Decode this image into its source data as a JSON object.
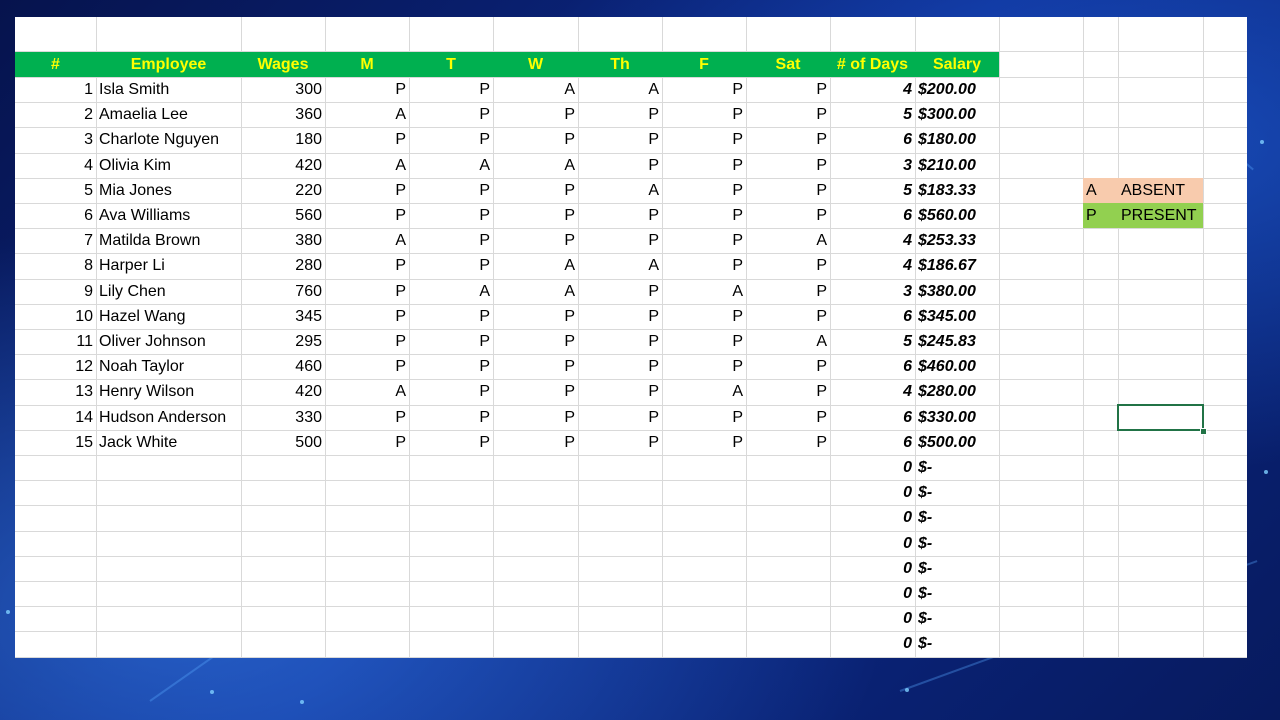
{
  "colors": {
    "header_bg": "#00b050",
    "header_text": "#ffff00",
    "absent_bg": "#f8cbad",
    "present_bg": "#92d050",
    "selection": "#217346"
  },
  "headers": [
    "#",
    "Employee",
    "Wages",
    "M",
    "T",
    "W",
    "Th",
    "F",
    "Sat",
    "# of Days",
    "Salary"
  ],
  "rows": [
    {
      "n": "1",
      "name": "Isla Smith",
      "wages": "300",
      "att": [
        "P",
        "P",
        "A",
        "A",
        "P",
        "P"
      ],
      "days": "4",
      "salary": "$200.00"
    },
    {
      "n": "2",
      "name": "Amaelia Lee",
      "wages": "360",
      "att": [
        "A",
        "P",
        "P",
        "P",
        "P",
        "P"
      ],
      "days": "5",
      "salary": "$300.00"
    },
    {
      "n": "3",
      "name": "Charlote Nguyen",
      "wages": "180",
      "att": [
        "P",
        "P",
        "P",
        "P",
        "P",
        "P"
      ],
      "days": "6",
      "salary": "$180.00"
    },
    {
      "n": "4",
      "name": "Olivia Kim",
      "wages": "420",
      "att": [
        "A",
        "A",
        "A",
        "P",
        "P",
        "P"
      ],
      "days": "3",
      "salary": "$210.00"
    },
    {
      "n": "5",
      "name": "Mia Jones",
      "wages": "220",
      "att": [
        "P",
        "P",
        "P",
        "A",
        "P",
        "P"
      ],
      "days": "5",
      "salary": "$183.33"
    },
    {
      "n": "6",
      "name": "Ava Williams",
      "wages": "560",
      "att": [
        "P",
        "P",
        "P",
        "P",
        "P",
        "P"
      ],
      "days": "6",
      "salary": "$560.00"
    },
    {
      "n": "7",
      "name": "Matilda Brown",
      "wages": "380",
      "att": [
        "A",
        "P",
        "P",
        "P",
        "P",
        "A"
      ],
      "days": "4",
      "salary": "$253.33"
    },
    {
      "n": "8",
      "name": "Harper Li",
      "wages": "280",
      "att": [
        "P",
        "P",
        "A",
        "A",
        "P",
        "P"
      ],
      "days": "4",
      "salary": "$186.67"
    },
    {
      "n": "9",
      "name": "Lily Chen",
      "wages": "760",
      "att": [
        "P",
        "A",
        "A",
        "P",
        "A",
        "P"
      ],
      "days": "3",
      "salary": "$380.00"
    },
    {
      "n": "10",
      "name": "Hazel Wang",
      "wages": "345",
      "att": [
        "P",
        "P",
        "P",
        "P",
        "P",
        "P"
      ],
      "days": "6",
      "salary": "$345.00"
    },
    {
      "n": "11",
      "name": "Oliver Johnson",
      "wages": "295",
      "att": [
        "P",
        "P",
        "P",
        "P",
        "P",
        "A"
      ],
      "days": "5",
      "salary": "$245.83"
    },
    {
      "n": "12",
      "name": "Noah Taylor",
      "wages": "460",
      "att": [
        "P",
        "P",
        "P",
        "P",
        "P",
        "P"
      ],
      "days": "6",
      "salary": "$460.00"
    },
    {
      "n": "13",
      "name": "Henry Wilson",
      "wages": "420",
      "att": [
        "A",
        "P",
        "P",
        "P",
        "A",
        "P"
      ],
      "days": "4",
      "salary": "$280.00"
    },
    {
      "n": "14",
      "name": "Hudson Anderson",
      "wages": "330",
      "att": [
        "P",
        "P",
        "P",
        "P",
        "P",
        "P"
      ],
      "days": "6",
      "salary": "$330.00"
    },
    {
      "n": "15",
      "name": "Jack White",
      "wages": "500",
      "att": [
        "P",
        "P",
        "P",
        "P",
        "P",
        "P"
      ],
      "days": "6",
      "salary": "$500.00"
    }
  ],
  "empty_rows": [
    {
      "days": "0",
      "salary": "$-"
    },
    {
      "days": "0",
      "salary": "$-"
    },
    {
      "days": "0",
      "salary": "$-"
    },
    {
      "days": "0",
      "salary": "$-"
    },
    {
      "days": "0",
      "salary": "$-"
    },
    {
      "days": "0",
      "salary": "$-"
    },
    {
      "days": "0",
      "salary": "$-"
    },
    {
      "days": "0",
      "salary": "$-"
    }
  ],
  "legend": [
    {
      "code": "A",
      "label": "ABSENT"
    },
    {
      "code": "P",
      "label": "PRESENT"
    }
  ]
}
